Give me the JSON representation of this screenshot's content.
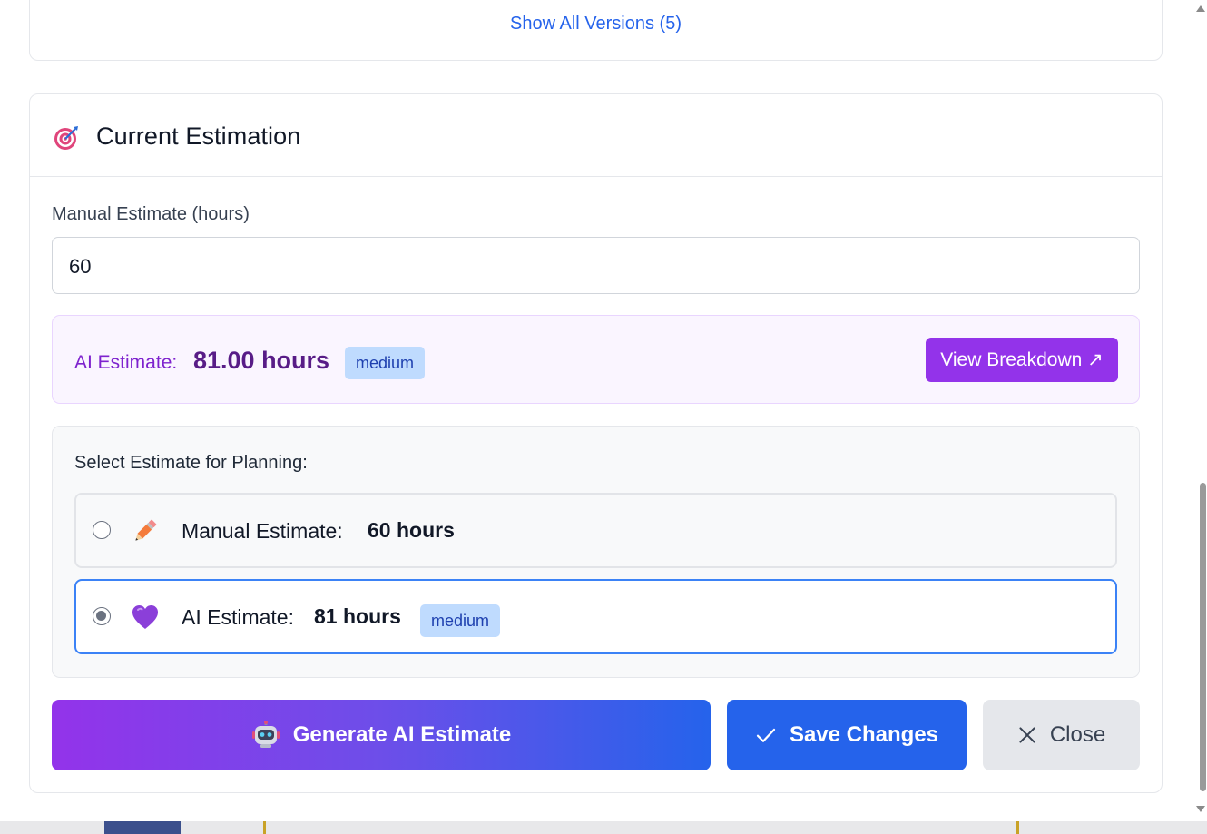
{
  "versions": {
    "show_all_label": "Show All Versions (5)"
  },
  "estimation": {
    "title": "Current Estimation",
    "manual_label": "Manual Estimate (hours)",
    "manual_value": "60",
    "ai_box": {
      "label": "AI Estimate:",
      "value": "81.00 hours",
      "confidence": "medium",
      "breakdown_button": "View Breakdown ↗"
    },
    "selection": {
      "label": "Select Estimate for Planning:",
      "options": [
        {
          "label": "Manual Estimate:",
          "value": "60 hours",
          "icon": "pencil-icon",
          "selected": false
        },
        {
          "label": "AI Estimate:",
          "value": "81 hours",
          "confidence": "medium",
          "icon": "purple-heart-icon",
          "selected": true
        }
      ]
    },
    "actions": {
      "generate": "Generate AI Estimate",
      "save": "Save Changes",
      "close": "Close"
    }
  },
  "colors": {
    "primary": "#2563eb",
    "purple": "#9333ea",
    "ai_text": "#7e22ce",
    "badge_bg": "#bfdbfe"
  }
}
